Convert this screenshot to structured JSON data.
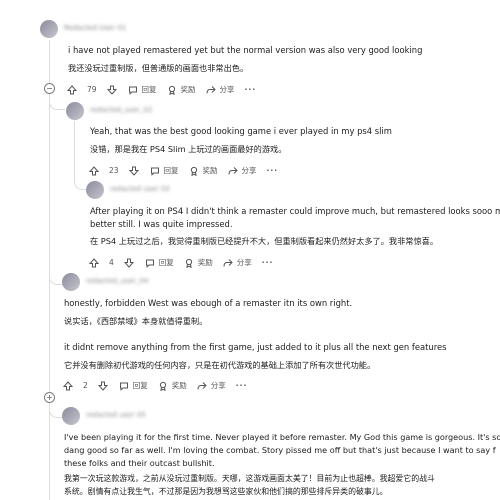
{
  "comments": [
    {
      "username": "Redacted User 01",
      "en": "i have not played remastered yet but the normal version was also very good looking",
      "cn": "我还没玩过重制版，但普通版的画面也非常出色。",
      "score": "79",
      "reply": "回复",
      "award": "奖励",
      "share": "分享"
    },
    {
      "username": "redacted_user_02",
      "en": "Yeah, that was the best good looking game i ever played in my ps4 slim",
      "cn": "没错，那是我在 PS4 Slim 上玩过的画面最好的游戏。",
      "score": "23",
      "reply": "回复",
      "award": "奖励",
      "share": "分享"
    },
    {
      "username": "redacted user 03",
      "en1": "After playing it on PS4 I didn't think a remaster could improve much, but remastered looks sooo much",
      "en2": "better still. I was quite impressed.",
      "cn": "在 PS4 上玩过之后，我觉得重制版已经提升不大，但重制版看起来仍然好太多了。我非常惊喜。",
      "score": "4",
      "reply": "回复",
      "award": "奖励",
      "share": "分享"
    },
    {
      "username": "redacted_user_04",
      "en1": "honestly, forbidden West was ebough of a remaster itn its own right.",
      "cn1": "说实话，《西部禁域》本身就值得重制。",
      "en2": "it didnt remove anything from the first game, just added to it plus all the next gen features",
      "cn2": "它并没有删除初代游戏的任何内容，只是在初代游戏的基础上添加了所有次世代功能。",
      "score": "2",
      "reply": "回复",
      "award": "奖励",
      "share": "分享"
    },
    {
      "username": "redacted user 05",
      "en1": "I've been playing it for the first time. Never played it before remaster. My God this game is gorgeous. It's so",
      "en2": "dang good so far as well. I'm loving the combat. Story pissed me off but that's just because I want to say f",
      "en3": "these folks and their outcast bullshit.",
      "cn1": "我第一次玩这款游戏，之前从没玩过重制版。天哪，这游戏画面太美了！目前为止也超棒。我超爱它的战斗",
      "cn2": "系统。剧情有点让我生气，不过那是因为我想骂这些家伙和他们搞的那些排斥异类的破事儿。"
    }
  ],
  "icons": {
    "upvote": "arrow-up-icon",
    "downvote": "arrow-down-icon",
    "reply": "speech-bubble-icon",
    "award": "award-ribbon-icon",
    "share": "share-arrow-icon",
    "more": "more-dots-icon",
    "collapse": "collapse-minus-icon",
    "expand": "expand-plus-icon"
  },
  "more_label": "···",
  "colors": {
    "thread_line": "#dcdcdc",
    "text": "#1c1c1c",
    "meta": "#555555"
  }
}
